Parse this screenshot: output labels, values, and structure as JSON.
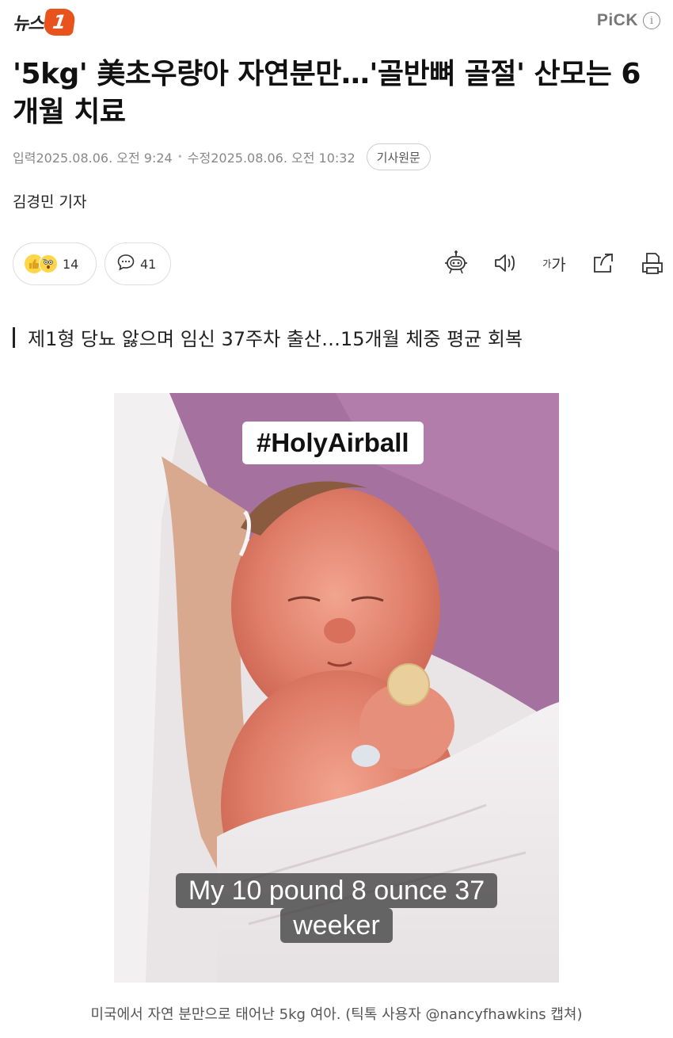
{
  "header": {
    "logo_text": "뉴스",
    "logo_badge": "1",
    "pick_label": "PiCK",
    "pick_info_glyph": "i"
  },
  "article": {
    "headline": "'5kg' 美초우량아 자연분만…'골반뼈 골절' 산모는 6개월 치료",
    "meta": {
      "input_label": "입력",
      "input_datetime": "2025.08.06. 오전 9:24",
      "update_label": "수정",
      "update_datetime": "2025.08.06. 오전 10:32",
      "original_button": "기사원문"
    },
    "reporter": "김경민 기자",
    "reactions": {
      "like_count": "14",
      "comment_count": "41"
    },
    "tools": {
      "font_size_label_small": "가",
      "font_size_label_large": "가"
    },
    "subheadline": "제1형 당뇨 앓으며 임신 37주차 출산…15개월 체중 평균 회복",
    "photo": {
      "hashtag": "#HolyAirball",
      "overlay_line1": "My 10 pound 8 ounce 37",
      "overlay_line2": "weeker"
    },
    "photo_caption": "미국에서 자연 분만으로 태어난 5kg 여아. (틱톡 사용자 @nancyfhawkins 캡쳐)"
  },
  "icons": {
    "robot": "robot-icon",
    "speaker": "speaker-icon",
    "font_size": "font-size-icon",
    "share": "share-icon",
    "print": "print-icon",
    "comment": "comment-bubble-icon",
    "like": "thumbs-up-icon"
  },
  "colors": {
    "brand": "#e8531d",
    "text": "#111111",
    "muted": "#888888"
  }
}
